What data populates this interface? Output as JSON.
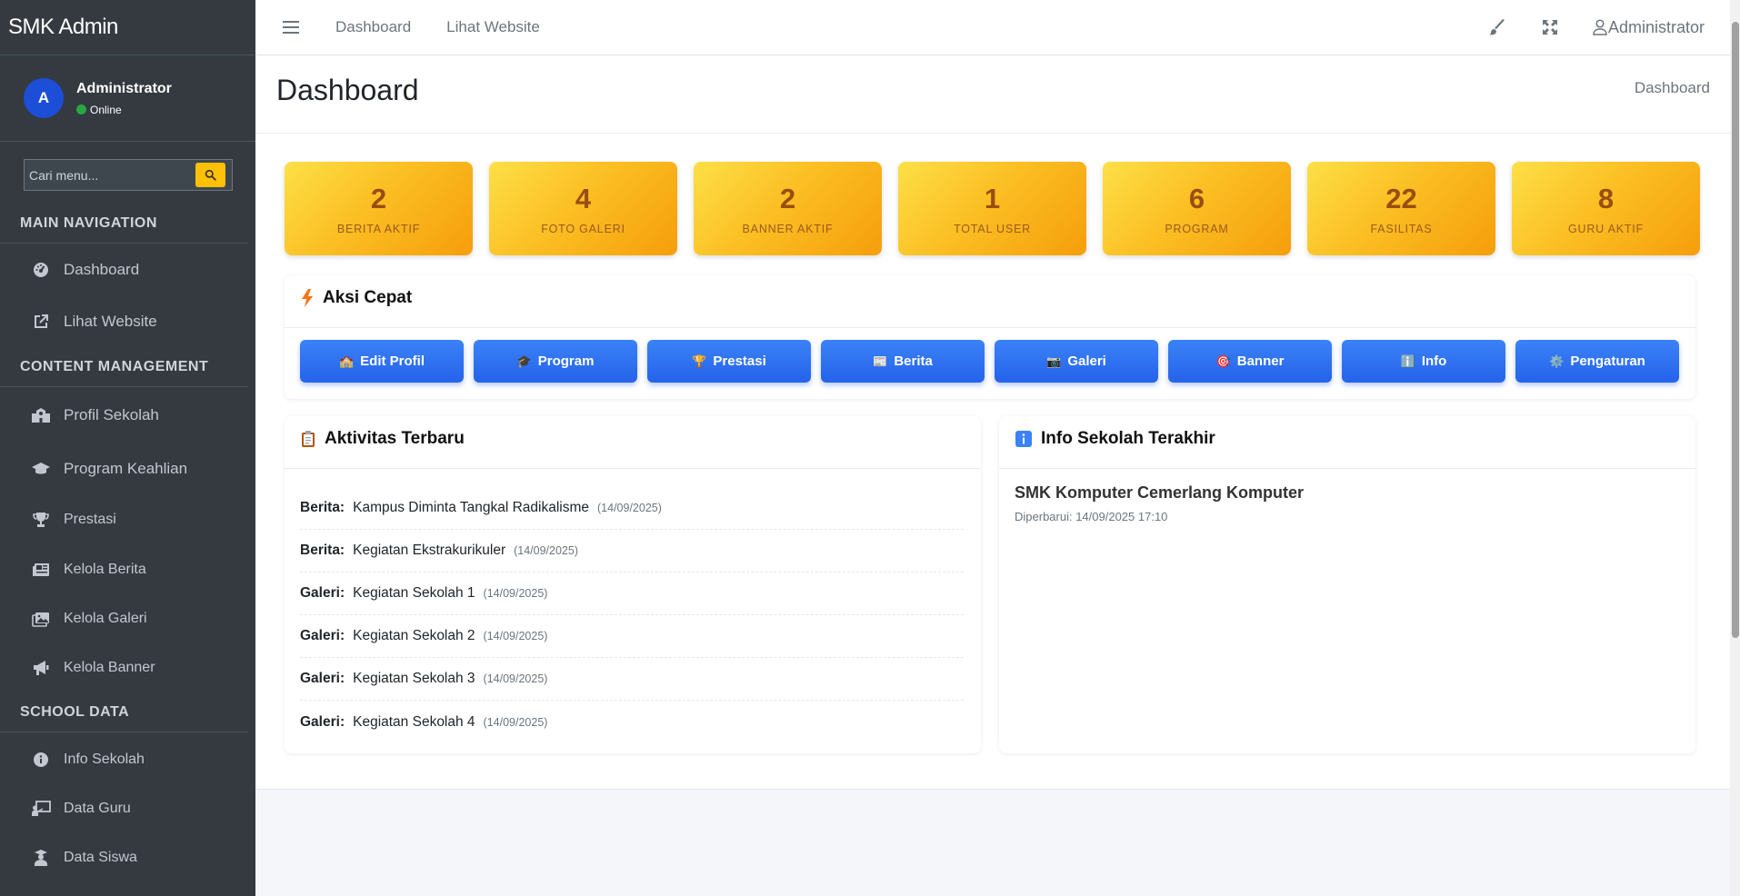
{
  "brand": "SMK Admin",
  "user": {
    "initial": "A",
    "name": "Administrator",
    "status": "Online"
  },
  "search": {
    "placeholder": "Cari menu..."
  },
  "nav": {
    "header_main": "MAIN NAVIGATION",
    "main_items": [
      {
        "label": "Dashboard",
        "icon": "dashboard-gauge-icon"
      },
      {
        "label": "Lihat Website",
        "icon": "external-link-icon"
      }
    ],
    "header_content": "CONTENT MANAGEMENT",
    "content_items": [
      {
        "label": "Profil Sekolah",
        "icon": "school-icon"
      },
      {
        "label": "Program Keahlian",
        "icon": "graduation-cap-icon"
      },
      {
        "label": "Prestasi",
        "icon": "trophy-icon"
      },
      {
        "label": "Kelola Berita",
        "icon": "newspaper-icon"
      },
      {
        "label": "Kelola Galeri",
        "icon": "images-icon"
      },
      {
        "label": "Kelola Banner",
        "icon": "bullhorn-icon"
      }
    ],
    "header_school": "SCHOOL DATA",
    "school_items": [
      {
        "label": "Info Sekolah",
        "icon": "info-circle-icon"
      },
      {
        "label": "Data Guru",
        "icon": "teacher-board-icon"
      },
      {
        "label": "Data Siswa",
        "icon": "student-icon"
      }
    ]
  },
  "topbar": {
    "link_dashboard": "Dashboard",
    "link_website": "Lihat Website",
    "user_label": "Administrator"
  },
  "page": {
    "title": "Dashboard",
    "breadcrumb": "Dashboard"
  },
  "stats": [
    {
      "value": "2",
      "label": "BERITA AKTIF"
    },
    {
      "value": "4",
      "label": "FOTO GALERI"
    },
    {
      "value": "2",
      "label": "BANNER AKTIF"
    },
    {
      "value": "1",
      "label": "TOTAL USER"
    },
    {
      "value": "6",
      "label": "PROGRAM"
    },
    {
      "value": "22",
      "label": "FASILITAS"
    },
    {
      "value": "8",
      "label": "GURU AKTIF"
    }
  ],
  "quick_actions": {
    "title": "Aksi Cepat",
    "buttons": [
      {
        "emoji": "🏫",
        "label": "Edit Profil"
      },
      {
        "emoji": "🎓",
        "label": "Program"
      },
      {
        "emoji": "🏆",
        "label": "Prestasi"
      },
      {
        "emoji": "📰",
        "label": "Berita"
      },
      {
        "emoji": "📷",
        "label": "Galeri"
      },
      {
        "emoji": "🎯",
        "label": "Banner"
      },
      {
        "emoji": "ℹ️",
        "label": "Info"
      },
      {
        "emoji": "⚙️",
        "label": "Pengaturan"
      }
    ]
  },
  "activity": {
    "title": "Aktivitas Terbaru",
    "rows": [
      {
        "type": "Berita:",
        "text": "Kampus Diminta Tangkal Radikalisme",
        "date": "(14/09/2025)"
      },
      {
        "type": "Berita:",
        "text": "Kegiatan Ekstrakurikuler",
        "date": "(14/09/2025)"
      },
      {
        "type": "Galeri:",
        "text": "Kegiatan Sekolah 1",
        "date": "(14/09/2025)"
      },
      {
        "type": "Galeri:",
        "text": "Kegiatan Sekolah 2",
        "date": "(14/09/2025)"
      },
      {
        "type": "Galeri:",
        "text": "Kegiatan Sekolah 3",
        "date": "(14/09/2025)"
      },
      {
        "type": "Galeri:",
        "text": "Kegiatan Sekolah 4",
        "date": "(14/09/2025)"
      }
    ]
  },
  "school_info": {
    "title": "Info Sekolah Terakhir",
    "name": "SMK Komputer Cemerlang Komputer",
    "updated": "Diperbarui: 14/09/2025 17:10"
  }
}
